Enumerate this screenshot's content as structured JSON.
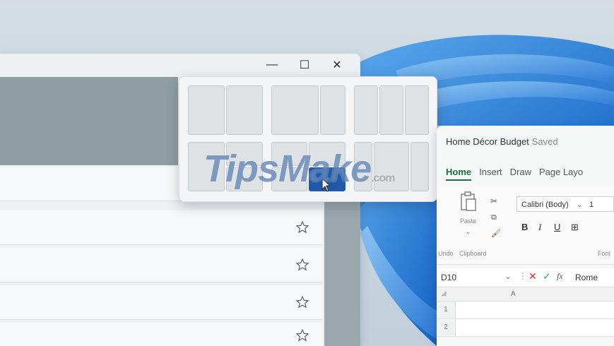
{
  "left_window": {
    "caption": {
      "minimize": "—",
      "maximize": "☐",
      "close": "✕"
    },
    "list_rows": 4
  },
  "snap_flyout": {
    "active_layout": "grid-2x2-bottom-right"
  },
  "watermark": {
    "brand": "TipsMake",
    "suffix": ".com"
  },
  "excel": {
    "doc_title": "Home Décor Budget",
    "status": "Saved",
    "tabs": [
      "Home",
      "Insert",
      "Draw",
      "Page Layo"
    ],
    "active_tab": "Home",
    "clipboard": {
      "paste": "Paste",
      "undo": "Undo",
      "group": "Clipboard"
    },
    "font": {
      "name": "Calibri (Body)",
      "size": "1",
      "group": "Font"
    },
    "formula_bar": {
      "cell_ref": "D10",
      "fx": "fx",
      "value": "Rome"
    },
    "grid": {
      "column": "A",
      "rows": [
        "1",
        "2"
      ]
    }
  },
  "colors": {
    "accent": "#1f5aa8",
    "excel_green": "#1d6b3f"
  }
}
